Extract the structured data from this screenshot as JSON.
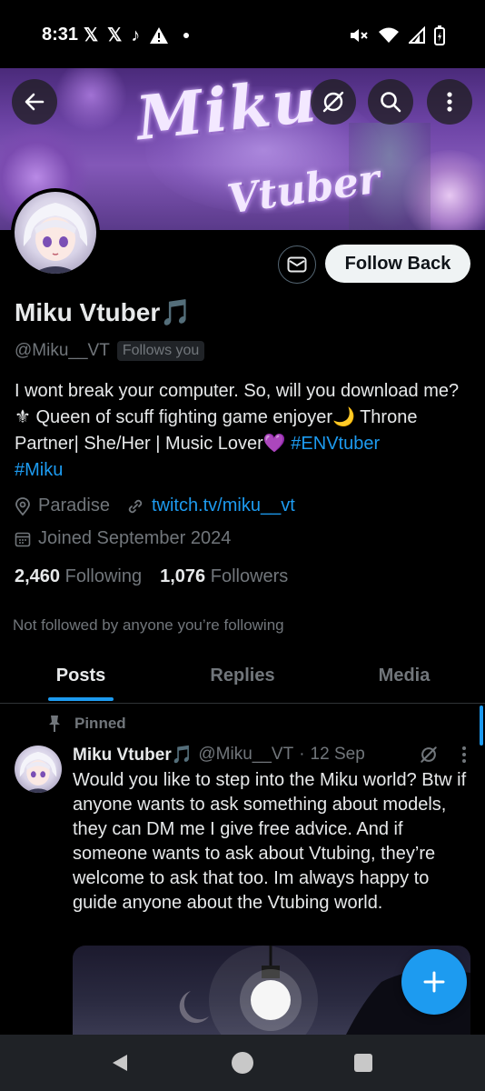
{
  "status_bar": {
    "time": "8:31",
    "left_icons": [
      "x-app-icon",
      "x-app-icon",
      "tiktok-icon",
      "warning-icon",
      "dot-icon"
    ],
    "right_icons": [
      "mute-icon",
      "wifi-icon",
      "signal-icon",
      "battery-icon"
    ]
  },
  "banner": {
    "title_line1": "Miku",
    "title_line2": "Vtuber"
  },
  "profile": {
    "name": "Miku Vtuber🎵",
    "handle": "@Miku__VT",
    "follows_you": "Follows you",
    "follow_back": "Follow Back",
    "bio_text": "I wont break your computer. So, will you download me? ⚜ Queen of scuff  fighting game enjoyer🌙 Throne Partner| She/Her | Music Lover💜 ",
    "bio_tag1": "#ENVtuber",
    "bio_tag2": "#Miku",
    "location": "Paradise",
    "website": "twitch.tv/miku__vt",
    "joined": "Joined September 2024",
    "following_count": "2,460",
    "following_label": "Following",
    "followers_count": "1,076",
    "followers_label": "Followers",
    "not_followed": "Not followed by anyone you’re following"
  },
  "tabs": [
    {
      "label": "Posts"
    },
    {
      "label": "Replies"
    },
    {
      "label": "Media"
    }
  ],
  "post": {
    "pinned_label": "Pinned",
    "author_name": "Miku Vtuber🎵",
    "author_handle": "@Miku__VT",
    "separator": "·",
    "date": "12 Sep",
    "text": "Would you like to step into the Miku world? Btw if anyone wants to ask something about models, they can DM me I give free advice. And if someone wants to ask about Vtubing, they’re welcome to ask that too. Im always happy to guide anyone about the Vtubing world."
  },
  "colors": {
    "accent": "#1d9bf0",
    "text_primary": "#e7e9ea",
    "text_secondary": "#71767b",
    "background": "#000000"
  }
}
